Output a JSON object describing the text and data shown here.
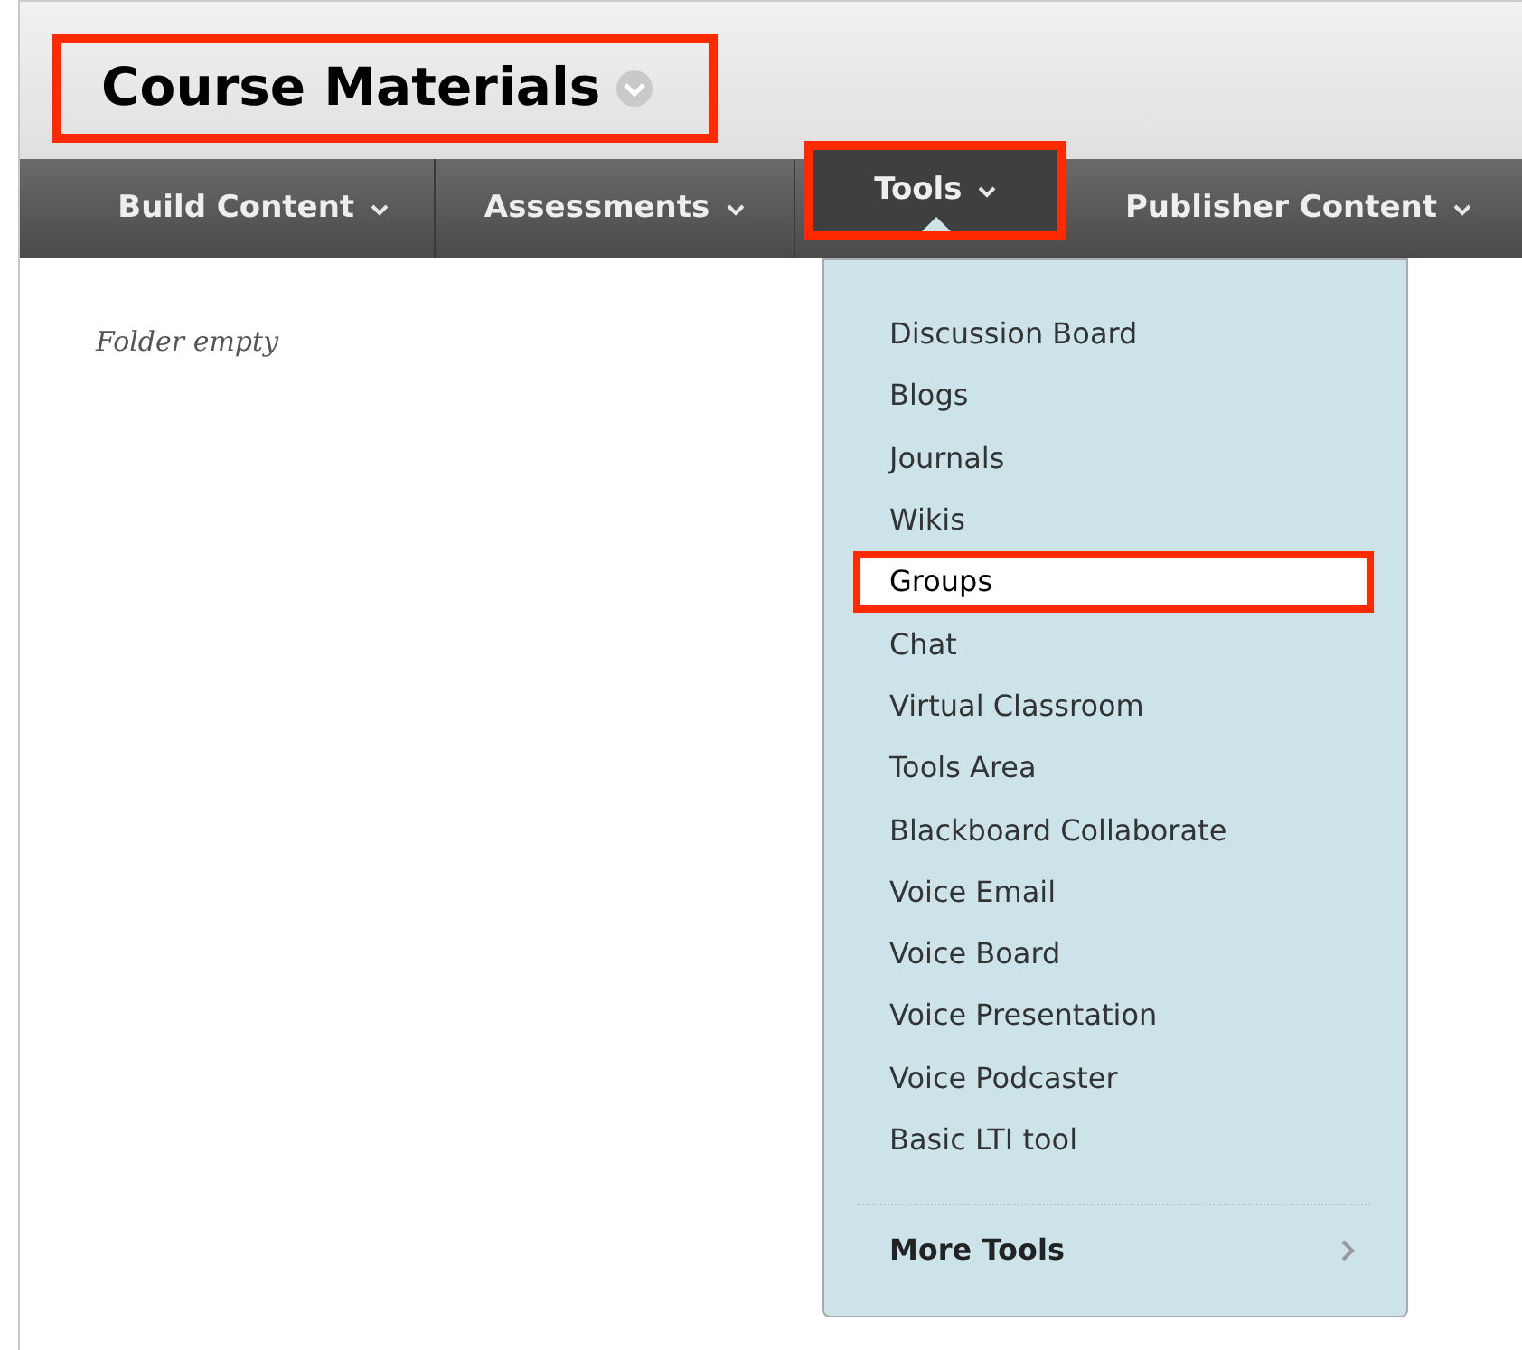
{
  "page_title": {
    "text": "Course Materials",
    "highlighted": true
  },
  "nav_tabs": [
    {
      "label": "Build Content",
      "selected": false,
      "highlighted": false
    },
    {
      "label": "Assessments",
      "selected": false,
      "highlighted": false
    },
    {
      "label": "Tools",
      "selected": true,
      "highlighted": true
    },
    {
      "label": "Publisher Content",
      "selected": false,
      "highlighted": false
    }
  ],
  "content": {
    "empty_message": "Folder empty"
  },
  "tools_menu": {
    "items": [
      {
        "label": "Discussion Board",
        "selected": false,
        "highlighted": false
      },
      {
        "label": "Blogs",
        "selected": false,
        "highlighted": false
      },
      {
        "label": "Journals",
        "selected": false,
        "highlighted": false
      },
      {
        "label": "Wikis",
        "selected": false,
        "highlighted": false
      },
      {
        "label": "Groups",
        "selected": true,
        "highlighted": true
      },
      {
        "label": "Chat",
        "selected": false,
        "highlighted": false
      },
      {
        "label": "Virtual Classroom",
        "selected": false,
        "highlighted": false
      },
      {
        "label": "Tools Area",
        "selected": false,
        "highlighted": false
      },
      {
        "label": "Blackboard Collaborate",
        "selected": false,
        "highlighted": false
      },
      {
        "label": "Voice Email",
        "selected": false,
        "highlighted": false
      },
      {
        "label": "Voice Board",
        "selected": false,
        "highlighted": false
      },
      {
        "label": "Voice Presentation",
        "selected": false,
        "highlighted": false
      },
      {
        "label": "Voice Podcaster",
        "selected": false,
        "highlighted": false
      },
      {
        "label": "Basic LTI tool",
        "selected": false,
        "highlighted": false
      }
    ],
    "more": {
      "label": "More Tools"
    }
  }
}
